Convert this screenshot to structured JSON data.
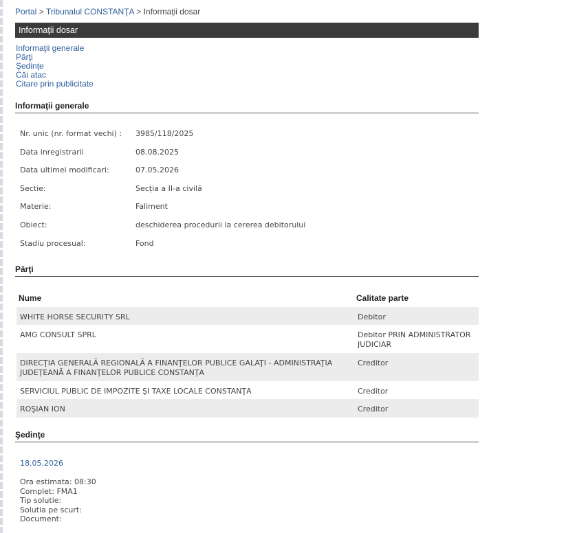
{
  "breadcrumb": {
    "portal": "Portal",
    "sep1": ">",
    "court": "Tribunalul CONSTANŢA",
    "sep2": ">",
    "current": "Informaţii dosar"
  },
  "title_bar": "Informaţii dosar",
  "nav_links": [
    "Informaţii generale",
    "Părţi",
    "Şedinţe",
    "Căi atac",
    "Citare prin publicitate"
  ],
  "general": {
    "heading": "Informaţii generale",
    "rows": [
      {
        "label": "Nr. unic (nr. format vechi) :",
        "value": "3985/118/2025"
      },
      {
        "label": "Data inregistrarii",
        "value": "08.08.2025"
      },
      {
        "label": "Data ultimei modificari:",
        "value": "07.05.2026"
      },
      {
        "label": "Sectie:",
        "value": "Secția a II-a civilă"
      },
      {
        "label": "Materie:",
        "value": "Faliment"
      },
      {
        "label": "Obiect:",
        "value": "deschiderea procedurii la cererea debitorului"
      },
      {
        "label": "Stadiu procesual:",
        "value": "Fond"
      }
    ]
  },
  "parties": {
    "heading": "Părţi",
    "col_name": "Nume",
    "col_role": "Calitate parte",
    "rows": [
      {
        "name": "WHITE HORSE SECURITY SRL",
        "role": "Debitor"
      },
      {
        "name": "AMG CONSULT SPRL",
        "role": "Debitor PRIN ADMINISTRATOR JUDICIAR"
      },
      {
        "name": "DIRECŢIA GENERALĂ REGIONALĂ A FINANŢELOR PUBLICE GALAŢI - ADMINISTRAŢIA JUDEŢEANĂ A FINANŢELOR PUBLICE CONSTANŢA",
        "role": "Creditor"
      },
      {
        "name": "SERVICIUL PUBLIC DE IMPOZITE ŞI TAXE LOCALE CONSTANŢA",
        "role": "Creditor"
      },
      {
        "name": "ROŞIAN ION",
        "role": "Creditor"
      }
    ]
  },
  "hearings": {
    "heading": "Şedinţe",
    "date": "18.05.2026",
    "details": [
      "Ora estimata: 08:30",
      "Complet: FMA1",
      "Tip solutie:",
      "Solutia pe scurt:",
      "Document:"
    ]
  }
}
